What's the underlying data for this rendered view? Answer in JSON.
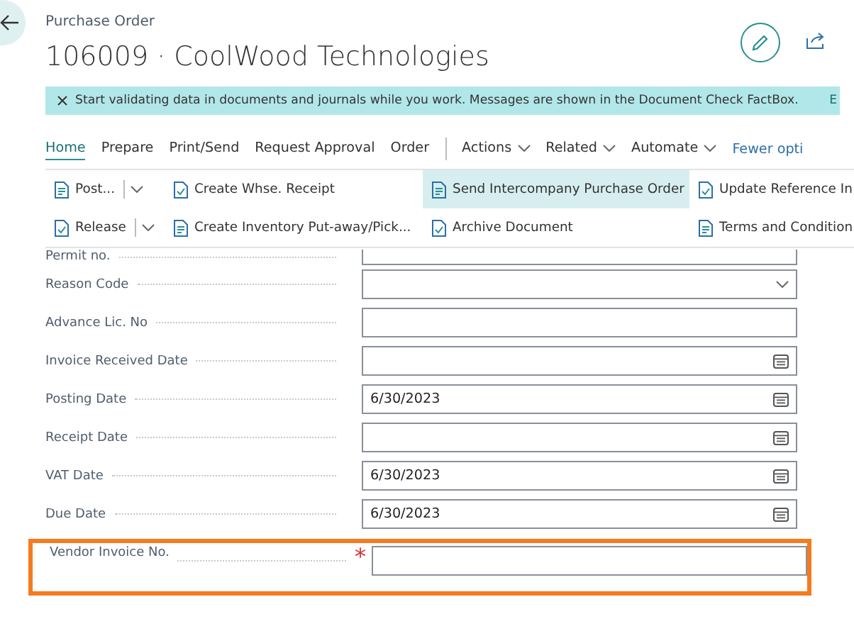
{
  "header": {
    "subtitle": "Purchase Order",
    "title": "106009 · CoolWood Technologies"
  },
  "banner": {
    "message": "Start validating data in documents and journals while you work. Messages are shown in the Document Check FactBox.",
    "link": "E"
  },
  "tabs": [
    {
      "label": "Home",
      "selected": true,
      "kind": "tab"
    },
    {
      "label": "Prepare",
      "selected": false,
      "kind": "tab"
    },
    {
      "label": "Print/Send",
      "selected": false,
      "kind": "tab"
    },
    {
      "label": "Request Approval",
      "selected": false,
      "kind": "tab"
    },
    {
      "label": "Order",
      "selected": false,
      "kind": "tab"
    },
    {
      "label": "Actions",
      "selected": false,
      "kind": "menu"
    },
    {
      "label": "Related",
      "selected": false,
      "kind": "menu"
    },
    {
      "label": "Automate",
      "selected": false,
      "kind": "menu"
    },
    {
      "label": "Fewer opti",
      "selected": false,
      "kind": "link"
    }
  ],
  "action_rows": [
    [
      {
        "label": "Post...",
        "split": true,
        "highlighted": false
      },
      {
        "label": "Create Whse. Receipt",
        "split": false,
        "highlighted": false
      },
      {
        "label": "Send Intercompany Purchase Order",
        "split": false,
        "highlighted": true
      },
      {
        "label": "Update Reference In",
        "split": false,
        "highlighted": false
      }
    ],
    [
      {
        "label": "Release",
        "split": true,
        "highlighted": false
      },
      {
        "label": "Create Inventory Put-away/Pick...",
        "split": false,
        "highlighted": false
      },
      {
        "label": "Archive Document",
        "split": false,
        "highlighted": false
      },
      {
        "label": "Terms and Condition",
        "split": false,
        "highlighted": false
      }
    ]
  ],
  "fields": [
    {
      "label": "Permit no.",
      "kind": "text",
      "highlighted": false
    },
    {
      "label": "Reason Code",
      "kind": "dropdown",
      "highlighted": false
    },
    {
      "label": "Advance Lic. No",
      "kind": "text",
      "highlighted": false
    },
    {
      "label": "Invoice Received Date",
      "kind": "date",
      "highlighted": false
    },
    {
      "label": "Posting Date",
      "kind": "date",
      "value": "6/30/2023",
      "highlighted": false
    },
    {
      "label": "Receipt Date",
      "kind": "date",
      "highlighted": false
    },
    {
      "label": "VAT Date",
      "kind": "date",
      "value": "6/30/2023",
      "highlighted": false
    },
    {
      "label": "Due Date",
      "kind": "date",
      "value": "6/30/2023",
      "highlighted": false
    },
    {
      "label": "Vendor Invoice No.",
      "kind": "text",
      "required_mark": "*",
      "highlighted": true
    }
  ]
}
